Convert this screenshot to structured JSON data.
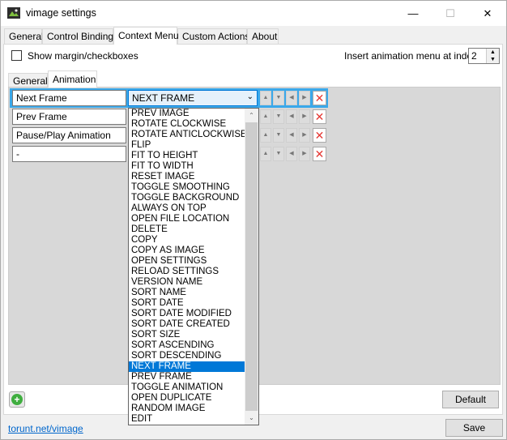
{
  "window": {
    "title": "vimage settings"
  },
  "titlebar_controls": {
    "minimize": "—",
    "maximize": "☐",
    "close": "✕"
  },
  "top_tabs": [
    "General",
    "Control Bindings",
    "Context Menu",
    "Custom Actions",
    "About"
  ],
  "top_tabs_active": "Context Menu",
  "show_margin_label": "Show margin/checkboxes",
  "insert_animation": {
    "label": "Insert animation menu at index",
    "value": "2"
  },
  "inner_tabs": [
    "General",
    "Animation"
  ],
  "inner_tabs_active": "Animation",
  "rows": [
    {
      "name": "Next Frame",
      "action": "NEXT FRAME"
    },
    {
      "name": "Prev Frame",
      "action": ""
    },
    {
      "name": "Pause/Play Animation",
      "action": ""
    },
    {
      "name": "-",
      "action": ""
    }
  ],
  "dropdown_items": [
    "PREV IMAGE",
    "ROTATE CLOCKWISE",
    "ROTATE ANTICLOCKWISE",
    "FLIP",
    "FIT TO HEIGHT",
    "FIT TO WIDTH",
    "RESET IMAGE",
    "TOGGLE SMOOTHING",
    "TOGGLE BACKGROUND",
    "ALWAYS ON TOP",
    "OPEN FILE LOCATION",
    "DELETE",
    "COPY",
    "COPY AS IMAGE",
    "OPEN SETTINGS",
    "RELOAD SETTINGS",
    "VERSION NAME",
    "SORT NAME",
    "SORT DATE",
    "SORT DATE MODIFIED",
    "SORT DATE CREATED",
    "SORT SIZE",
    "SORT ASCENDING",
    "SORT DESCENDING",
    "NEXT FRAME",
    "PREV FRAME",
    "TOGGLE ANIMATION",
    "OPEN DUPLICATE",
    "RANDOM IMAGE",
    "EDIT"
  ],
  "dropdown_selected": "NEXT FRAME",
  "buttons": {
    "default": "Default",
    "save": "Save"
  },
  "footer_link": "torunt.net/vimage",
  "colors": {
    "selection": "#0078d7",
    "row_highlight": "#3aa8ea",
    "delete": "#e53935",
    "add": "#3fae3f"
  }
}
